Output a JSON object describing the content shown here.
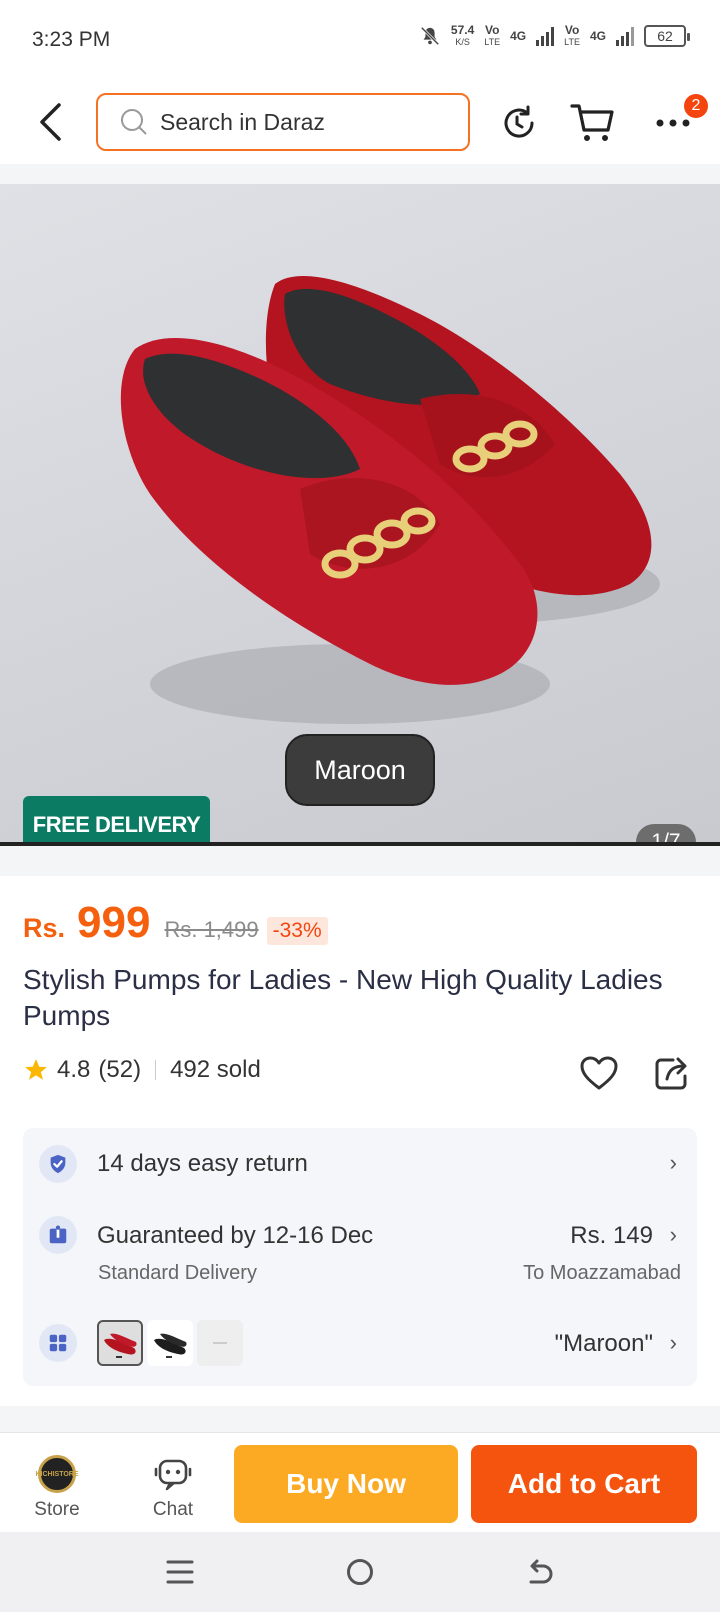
{
  "status_bar": {
    "time": "3:23 PM",
    "net_speed": "57.4",
    "net_unit": "K/S",
    "sim1_label": "Vo",
    "sim1_sub": "LTE",
    "sim1_type": "4G",
    "sim2_label": "Vo",
    "sim2_sub": "LTE",
    "sim2_type": "4G",
    "battery": "62"
  },
  "top_nav": {
    "search_placeholder": "Search in Daraz",
    "cart_badge": "2"
  },
  "gallery": {
    "variant_label": "Maroon",
    "free_delivery": "FREE DELIVERY",
    "page_counter": "1/7"
  },
  "product": {
    "currency": "Rs.",
    "price": "999",
    "original_price": "Rs. 1,499",
    "discount": "-33%",
    "title": "Stylish Pumps for Ladies - New High Quality Ladies Pumps",
    "rating": "4.8",
    "reviews": "(52)",
    "sold": "492 sold"
  },
  "services": {
    "return_text": "14 days easy return",
    "delivery_main": "Guaranteed by 12-16 Dec",
    "delivery_sub": "Standard Delivery",
    "delivery_fee": "Rs. 149",
    "delivery_location": "To Moazzamabad",
    "selected_variant": "\"Maroon\""
  },
  "action_bar": {
    "store_label": "Store",
    "store_logo_text": "KICHISTORE",
    "chat_label": "Chat",
    "buy_now_label": "Buy Now",
    "add_to_cart_label": "Add to Cart"
  },
  "colors": {
    "accent_orange": "#f57224",
    "buy_now": "#fcaa23",
    "add_to_cart": "#f5540f",
    "free_delivery_bg": "#0b7b63"
  }
}
